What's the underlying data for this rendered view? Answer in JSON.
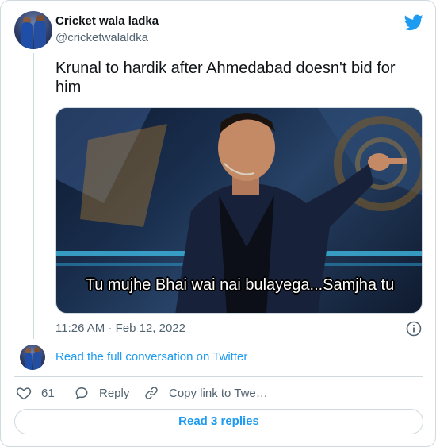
{
  "author": {
    "name": "Cricket wala ladka",
    "handle": "@cricketwalaldka"
  },
  "tweet": {
    "text": "Krunal to hardik after Ahmedabad doesn't bid for him",
    "media_caption": "Tu mujhe Bhai wai nai bulayega...Samjha tu",
    "timestamp": "11:26 AM · Feb 12, 2022"
  },
  "conversation_link": "Read the full conversation on Twitter",
  "actions": {
    "like_count": "61",
    "reply_label": "Reply",
    "copy_label": "Copy link to Twe…"
  },
  "replies_button": "Read 3 replies",
  "colors": {
    "accent": "#1d9bf0",
    "secondary_text": "#536471",
    "border": "#cfd9de"
  },
  "icons": [
    "twitter-bird-icon",
    "info-icon",
    "heart-icon",
    "reply-bubble-icon",
    "link-icon"
  ]
}
